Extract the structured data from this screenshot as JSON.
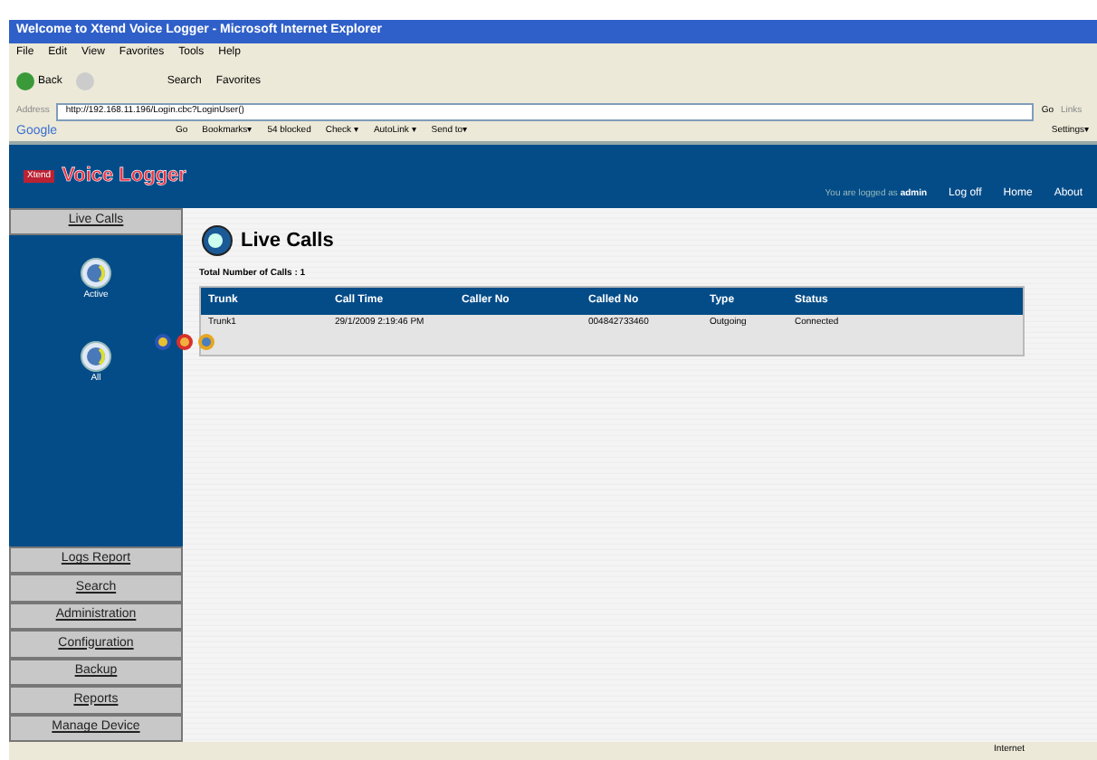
{
  "window": {
    "title": "Welcome to Xtend Voice Logger - Microsoft Internet Explorer"
  },
  "menu": [
    "File",
    "Edit",
    "View",
    "Favorites",
    "Tools",
    "Help"
  ],
  "toolbar": {
    "back": "Back",
    "search": "Search",
    "favorites": "Favorites"
  },
  "address": {
    "label": "Address",
    "url": "http://192.168.11.196/Login.cbc?LoginUser()",
    "go": "Go",
    "links": "Links"
  },
  "google_bar": {
    "logo": "Google",
    "items": [
      "Go",
      "Bookmarks▾",
      "54 blocked",
      "Check ▾",
      "AutoLink ▾",
      "Send to▾"
    ],
    "settings": "Settings▾"
  },
  "app": {
    "logo_small": "Xtend",
    "title": "Voice Logger",
    "logged_prefix": "You are logged as",
    "user": "admin",
    "links": [
      "Log off",
      "Home",
      "About"
    ]
  },
  "sidebar": {
    "top": "Live Calls",
    "icons": [
      {
        "label": "Active"
      },
      {
        "label": "All"
      }
    ],
    "items": [
      "Logs Report",
      "Search",
      "Administration",
      "Configuration",
      "Backup",
      "Reports",
      "Manage Device"
    ]
  },
  "page": {
    "title": "Live Calls",
    "total": "Total Number of Calls : 1"
  },
  "table": {
    "columns": [
      "Trunk",
      "Call Time",
      "Caller No",
      "Called No",
      "Type",
      "Status"
    ],
    "rows": [
      {
        "cells": [
          "Trunk1",
          "29/1/2009 2:19:46 PM",
          "",
          "004842733460",
          "Outgoing",
          "Connected"
        ]
      }
    ]
  },
  "status_bar": {
    "zone": "Internet"
  }
}
